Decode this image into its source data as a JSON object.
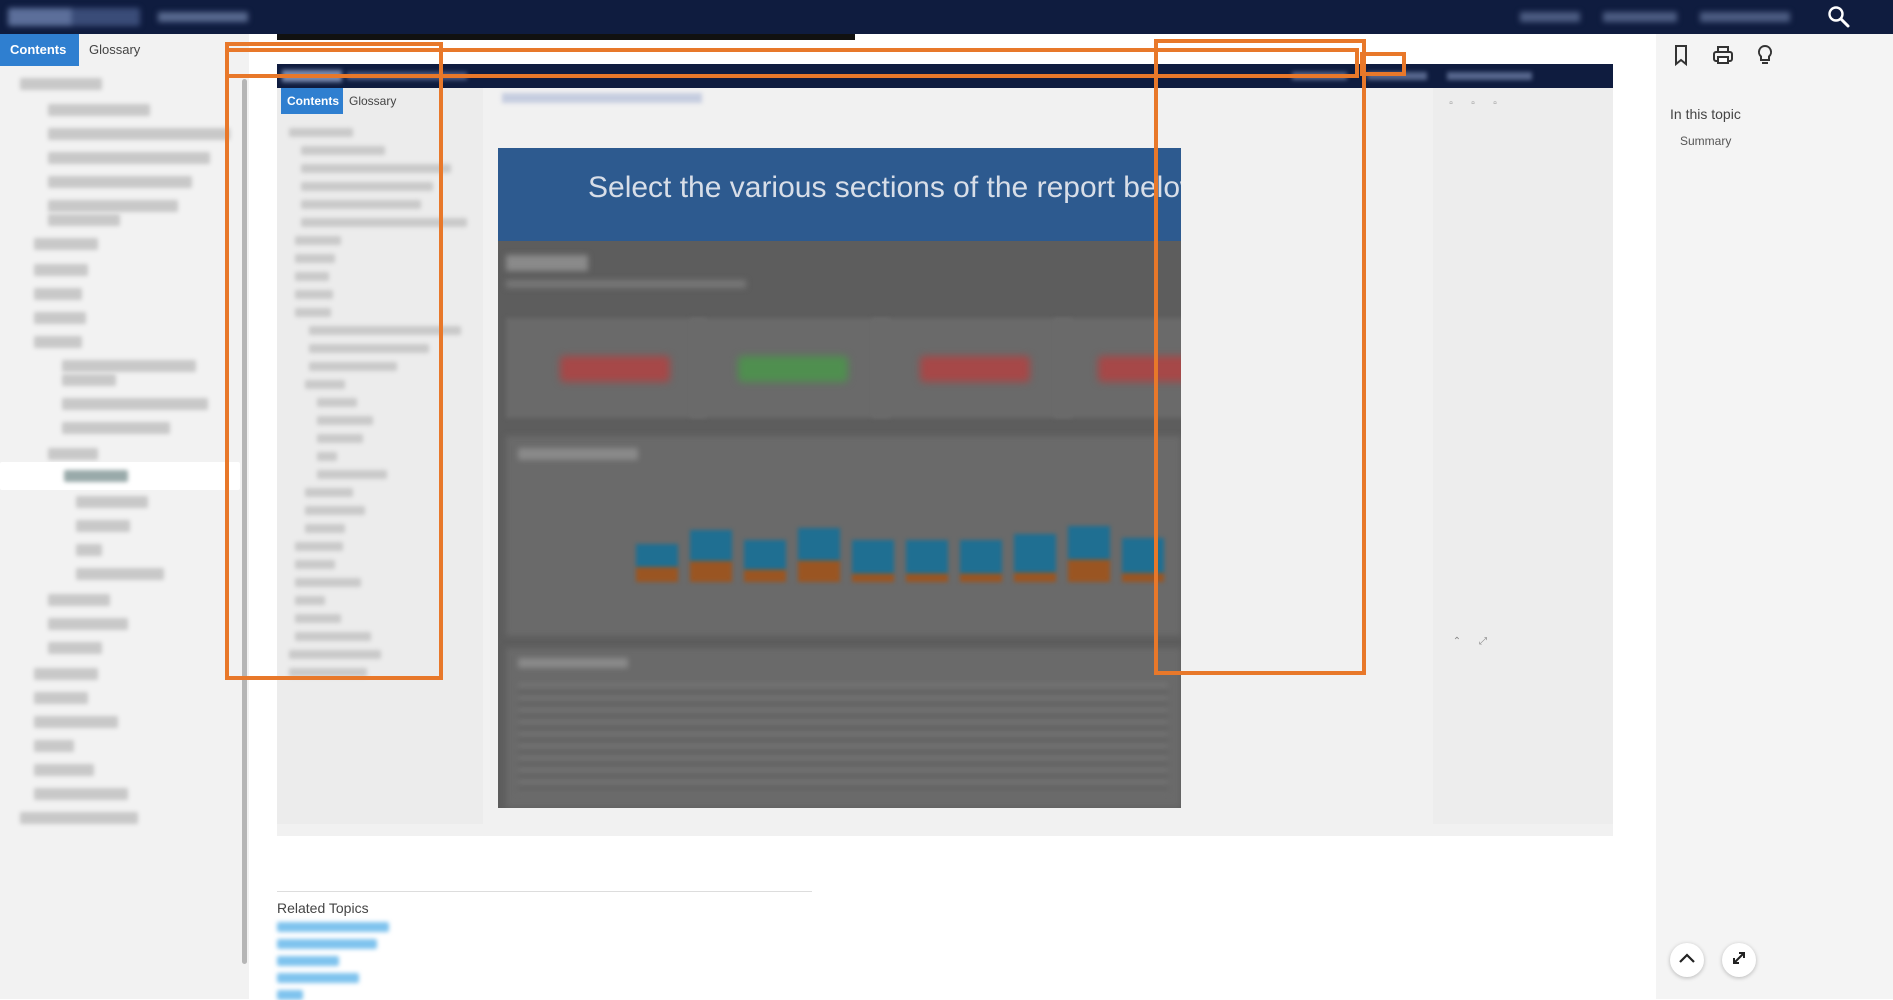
{
  "left_nav": {
    "tabs": [
      {
        "label": "Contents"
      },
      {
        "label": "Glossary"
      }
    ]
  },
  "embedded_screenshot": {
    "tabs": [
      {
        "label": "Contents"
      },
      {
        "label": "Glossary"
      }
    ],
    "report_title": "Select the various sections of the report below to exp"
  },
  "related": {
    "title": "Related Topics"
  },
  "right_sidebar": {
    "in_this_topic_label": "In this topic",
    "items": [
      {
        "label": "Summary"
      }
    ]
  },
  "icons": {
    "search": "search-icon",
    "bookmark": "bookmark-icon",
    "print": "print-icon",
    "lightbulb": "lightbulb-icon",
    "scroll_top": "chevron-up-icon",
    "expand": "expand-icon"
  },
  "colors": {
    "header_bg": "#0f1c3f",
    "accent_tab": "#2f7fd0",
    "highlight_orange": "#e8782a",
    "report_header": "#2d5a8f"
  }
}
